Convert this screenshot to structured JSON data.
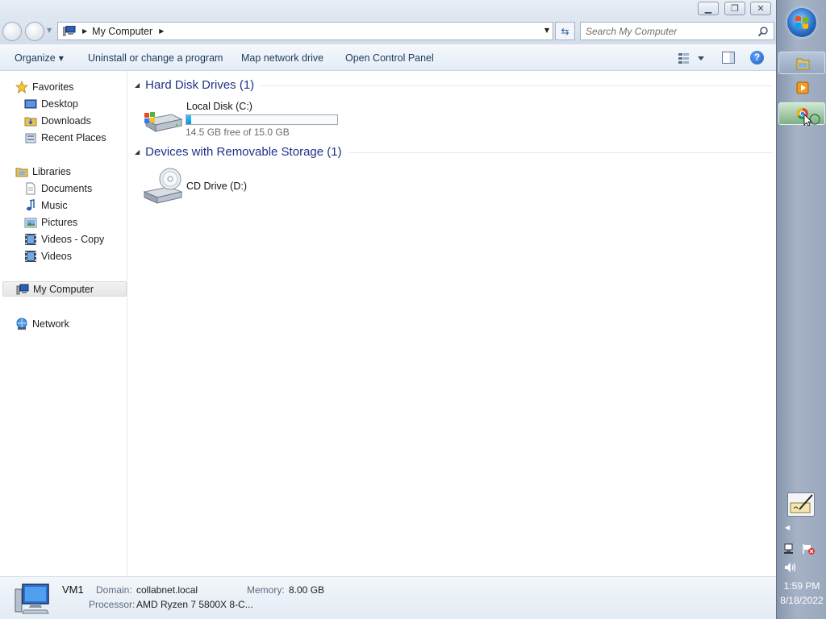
{
  "address": {
    "location": "My Computer"
  },
  "search": {
    "placeholder": "Search My Computer"
  },
  "toolbar": {
    "organize": "Organize",
    "uninstall": "Uninstall or change a program",
    "map_drive": "Map network drive",
    "control_panel": "Open Control Panel"
  },
  "nav": {
    "favorites": {
      "label": "Favorites",
      "items": [
        "Desktop",
        "Downloads",
        "Recent Places"
      ]
    },
    "libraries": {
      "label": "Libraries",
      "items": [
        "Documents",
        "Music",
        "Pictures",
        "Videos - Copy",
        "Videos"
      ]
    },
    "computer": "My Computer",
    "network": "Network"
  },
  "groups": {
    "hard_disks": {
      "title": "Hard Disk Drives (1)",
      "drives": [
        {
          "name": "Local Disk (C:)",
          "free_text": "14.5 GB free of 15.0 GB",
          "used_fraction": 0.033
        }
      ]
    },
    "removable": {
      "title": "Devices with Removable Storage (1)",
      "drives": [
        {
          "name": "CD Drive (D:)"
        }
      ]
    }
  },
  "details": {
    "name": "VM1",
    "domain_label": "Domain:",
    "domain": "collabnet.local",
    "memory_label": "Memory:",
    "memory": "8.00 GB",
    "processor_label": "Processor:",
    "processor": "AMD Ryzen 7 5800X 8-C..."
  },
  "taskbar": {
    "time": "1:59 PM",
    "date": "8/18/2022"
  },
  "colors": {
    "accent": "#1e3287",
    "progress": "#1ea0e8",
    "taskbar": "#9aa8bd"
  }
}
